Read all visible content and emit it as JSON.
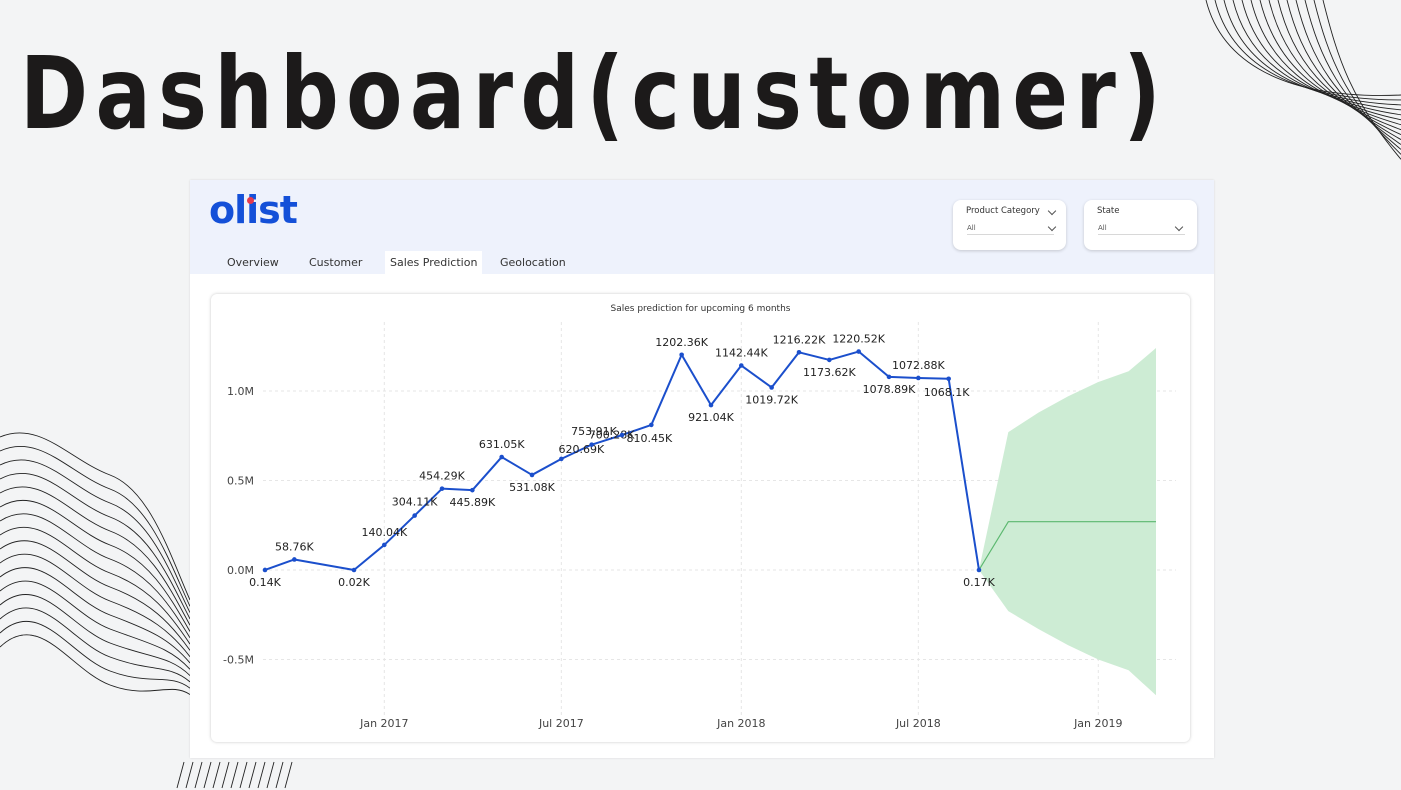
{
  "page": {
    "title": "Dashboard(customer)"
  },
  "report": {
    "logo": "olist",
    "tabs": [
      {
        "label": "Overview",
        "active": false
      },
      {
        "label": "Customer",
        "active": false
      },
      {
        "label": "Sales Prediction",
        "active": true
      },
      {
        "label": "Geolocation",
        "active": false
      }
    ],
    "slicers": [
      {
        "label": "Product Category",
        "value": "All",
        "icon": "chevron-down-icon"
      },
      {
        "label": "State",
        "value": "All",
        "icon": "chevron-down-icon"
      }
    ]
  },
  "colors": {
    "line": "#1b4fcc",
    "forecast_band": "#cdecd4",
    "forecast_line": "#5cb870",
    "brand": "#1450d8"
  },
  "chart_data": {
    "type": "line",
    "title": "Sales prediction for upcoming 6 months",
    "xlabel": "",
    "ylabel": "",
    "x_ticks": [
      "Jan 2017",
      "Jul 2017",
      "Jan 2018",
      "Jul 2018",
      "Jan 2019"
    ],
    "y_ticks": [
      "1.0M",
      "0.5M",
      "0.0M",
      "-0.5M"
    ],
    "ylim": [
      -0.75,
      1.35
    ],
    "grid": true,
    "series": [
      {
        "values": [
          {
            "x": "2016-09",
            "y": 0.14,
            "label": "0.14K"
          },
          {
            "x": "2016-10",
            "y": 58.76,
            "label": "58.76K"
          },
          {
            "x": "2016-12",
            "y": 0.02,
            "label": "0.02K"
          },
          {
            "x": "2017-01",
            "y": 140.04,
            "label": "140.04K"
          },
          {
            "x": "2017-02",
            "y": 304.11,
            "label": "304.11K"
          },
          {
            "x": "2017-03",
            "y": 454.29,
            "label": "454.29K"
          },
          {
            "x": "2017-04",
            "y": 445.89,
            "label": "445.89K"
          },
          {
            "x": "2017-05",
            "y": 631.05,
            "label": "631.05K"
          },
          {
            "x": "2017-06",
            "y": 531.08,
            "label": "531.08K"
          },
          {
            "x": "2017-07",
            "y": 620.69,
            "label": "620.69K"
          },
          {
            "x": "2017-08",
            "y": 700.28,
            "label": "700.28K"
          },
          {
            "x": "2017-09",
            "y": 753.91,
            "label": "753.91K"
          },
          {
            "x": "2017-10",
            "y": 810.45,
            "label": "810.45K"
          },
          {
            "x": "2017-11",
            "y": 1202.36,
            "label": "1202.36K"
          },
          {
            "x": "2017-12",
            "y": 921.04,
            "label": "921.04K"
          },
          {
            "x": "2018-01",
            "y": 1142.44,
            "label": "1142.44K"
          },
          {
            "x": "2018-02",
            "y": 1019.72,
            "label": "1019.72K"
          },
          {
            "x": "2018-03",
            "y": 1216.22,
            "label": "1216.22K"
          },
          {
            "x": "2018-04",
            "y": 1173.62,
            "label": "1173.62K"
          },
          {
            "x": "2018-05",
            "y": 1220.52,
            "label": "1220.52K"
          },
          {
            "x": "2018-06",
            "y": 1078.89,
            "label": "1078.89K"
          },
          {
            "x": "2018-07",
            "y": 1072.88,
            "label": "1072.88K"
          },
          {
            "x": "2018-08",
            "y": 1068.1,
            "label": "1068.1K"
          },
          {
            "x": "2018-09",
            "y": 0.17,
            "label": "0.17K"
          }
        ],
        "unit": "thousands"
      }
    ],
    "forecast": {
      "points": [
        {
          "x": "2018-09",
          "y": 0.0,
          "lower": 0.0,
          "upper": 0.0
        },
        {
          "x": "2018-10",
          "y": 0.27,
          "lower": -0.23,
          "upper": 0.77
        },
        {
          "x": "2018-11",
          "y": 0.27,
          "lower": -0.33,
          "upper": 0.88
        },
        {
          "x": "2018-12",
          "y": 0.27,
          "lower": -0.42,
          "upper": 0.97
        },
        {
          "x": "2019-01",
          "y": 0.27,
          "lower": -0.5,
          "upper": 1.05
        },
        {
          "x": "2019-02",
          "y": 0.27,
          "lower": -0.56,
          "upper": 1.11
        },
        {
          "x": "2019-03",
          "y": 0.27,
          "lower": -0.7,
          "upper": 1.24
        }
      ],
      "unit": "millions"
    }
  }
}
